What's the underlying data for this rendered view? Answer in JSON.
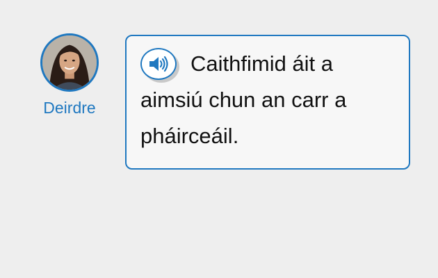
{
  "speaker": {
    "name": "Deirdre"
  },
  "message": {
    "text": "Caithfimid áit a aimsiú chun an carr a pháirceáil."
  },
  "colors": {
    "accent": "#1f78c0",
    "background": "#eeeeee",
    "bubble": "#f7f7f7"
  },
  "icons": {
    "audio": "speaker-volume-icon"
  }
}
